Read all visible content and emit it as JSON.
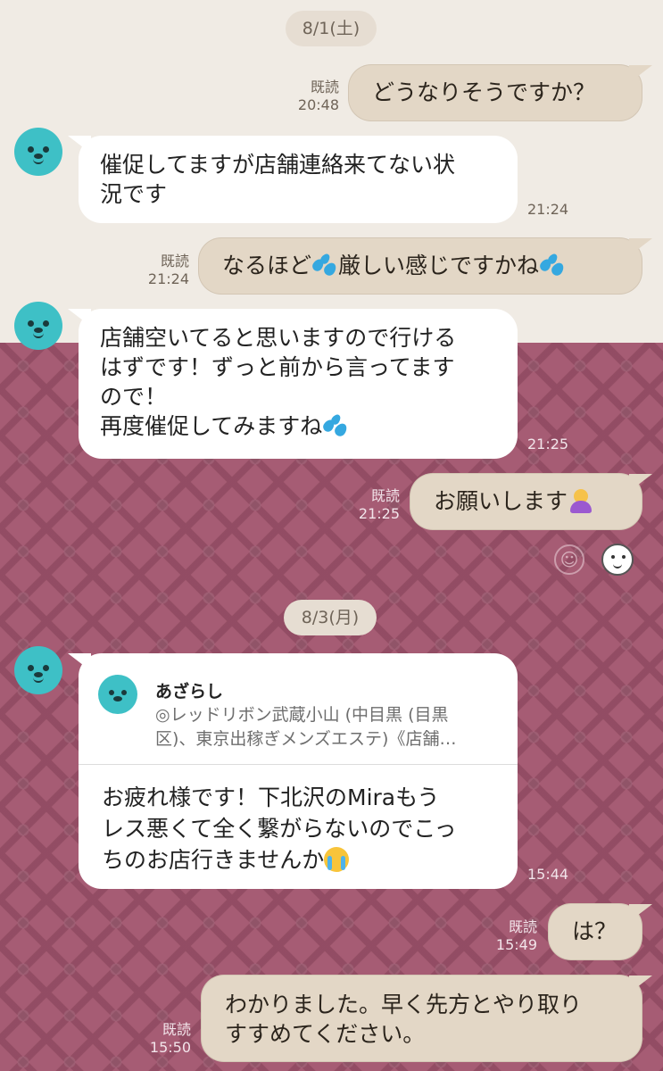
{
  "chat": {
    "date_1": "8/1(土)",
    "date_2": "8/3(月)",
    "read_label": "既読",
    "messages": {
      "m1": {
        "text": "どうなりそうですか？",
        "time": "20:48"
      },
      "m2": {
        "line1": "催促してますが店舗連絡来てない状",
        "line2": "況です",
        "time": "21:24"
      },
      "m3": {
        "text_a": "なるほど",
        "text_b": "厳しい感じですかね",
        "time": "21:24",
        "emoji": "sweat-droplets"
      },
      "m4": {
        "line1": "店舗空いてると思いますので行ける",
        "line2": "はずです！ずっと前から言ってます",
        "line3": "ので！",
        "line4": "再度催促してみますね",
        "time": "21:25",
        "emoji": "sweat-droplets"
      },
      "m5": {
        "text": "お願いします",
        "time": "21:25",
        "emoji": "person-bowing"
      },
      "m6": {
        "quote_name": "あざらし",
        "quote_line1": "◎レッドリボン武蔵小山 (中目黒 (目黒",
        "quote_line2": "区)、東京出稼ぎメンズエステ)《店舗…",
        "line1": "お疲れ様です！下北沢のMiraもう",
        "line2": "レス悪くて全く繋がらないのでこっ",
        "line3": "ちのお店行きませんか",
        "time": "15:44",
        "emoji": "loudly-crying-face"
      },
      "m7": {
        "text": "は？",
        "time": "15:49"
      },
      "m8": {
        "line1": "わかりました。早く先方とやり取り",
        "line2": "すすめてください。",
        "time": "15:50"
      }
    }
  },
  "colors": {
    "top_background": "#f0ebe4",
    "pattern_background": "#a65c74",
    "incoming_bubble": "#ffffff",
    "outgoing_bubble": "#e3d7c6",
    "avatar": "#3ec0c6"
  },
  "icons": [
    "seal-avatar-icon",
    "reaction-smiley-icon",
    "sticker-seal-icon"
  ]
}
